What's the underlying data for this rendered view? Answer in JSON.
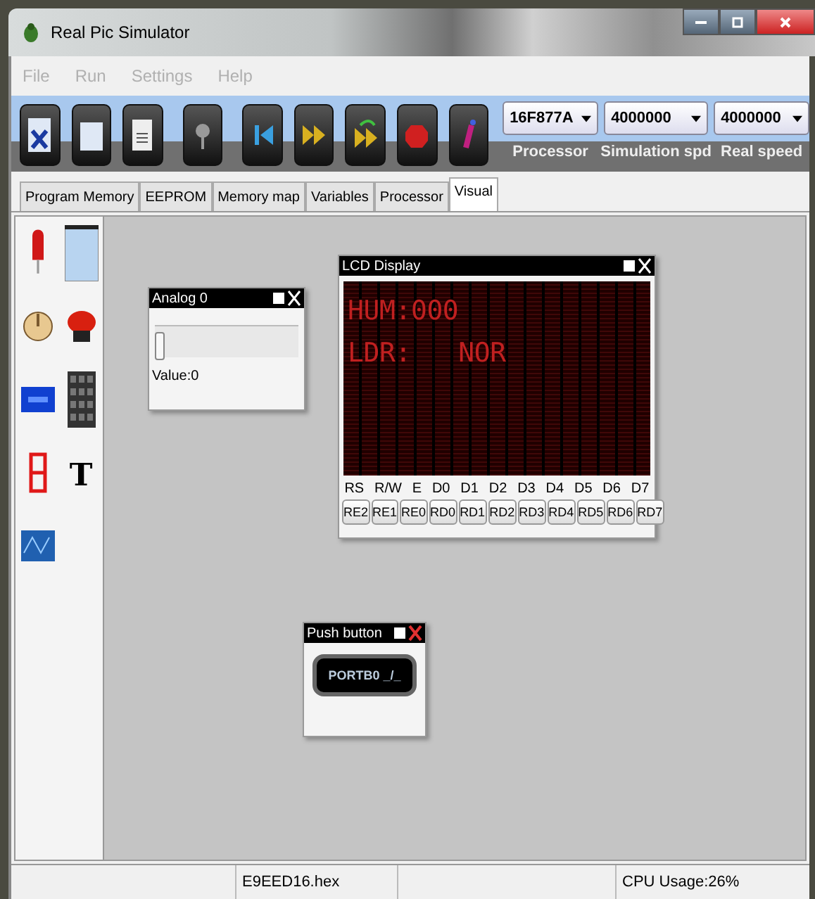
{
  "window": {
    "title": "Real Pic Simulator"
  },
  "menu": [
    {
      "label": "File",
      "disabled": true
    },
    {
      "label": "Run",
      "disabled": true
    },
    {
      "label": "Settings",
      "disabled": true
    },
    {
      "label": "Help",
      "disabled": true
    }
  ],
  "selectors": [
    {
      "value": "16F877A",
      "label": "Processor"
    },
    {
      "value": "4000000",
      "label": "Simulation spd"
    },
    {
      "value": "4000000",
      "label": "Real speed"
    }
  ],
  "tabs": [
    {
      "label": "Program Memory",
      "selected": false
    },
    {
      "label": "EEPROM",
      "selected": false
    },
    {
      "label": "Memory map",
      "selected": false
    },
    {
      "label": "Variables",
      "selected": false
    },
    {
      "label": "Processor",
      "selected": false
    },
    {
      "label": "Visual",
      "selected": true
    }
  ],
  "palette": [
    {
      "kind": "led"
    },
    {
      "kind": "lcd-window"
    },
    {
      "kind": "knob"
    },
    {
      "kind": "push"
    },
    {
      "kind": "lcd"
    },
    {
      "kind": "keypad"
    },
    {
      "kind": "segment"
    },
    {
      "kind": "text",
      "label": "T"
    },
    {
      "kind": "scope"
    }
  ],
  "analog": {
    "title": "Analog 0",
    "level": 0,
    "value": "Value:0"
  },
  "lcd": {
    "title": "LCD Display",
    "lines": [
      "HUM:000",
      "LDR:   NOR"
    ],
    "pins": [
      "RS",
      "R/W",
      "E",
      "D0",
      "D1",
      "D2",
      "D3",
      "D4",
      "D5",
      "D6",
      "D7"
    ],
    "ports": [
      "RE2",
      "RE1",
      "RE0",
      "RD0",
      "RD1",
      "RD2",
      "RD3",
      "RD4",
      "RD5",
      "RD6",
      "RD7"
    ]
  },
  "push_button": {
    "title": "Push button",
    "label": "PORTB0 _/_"
  },
  "status_bar": [
    "E9EED16.hex",
    "CPU Usage:26%"
  ]
}
